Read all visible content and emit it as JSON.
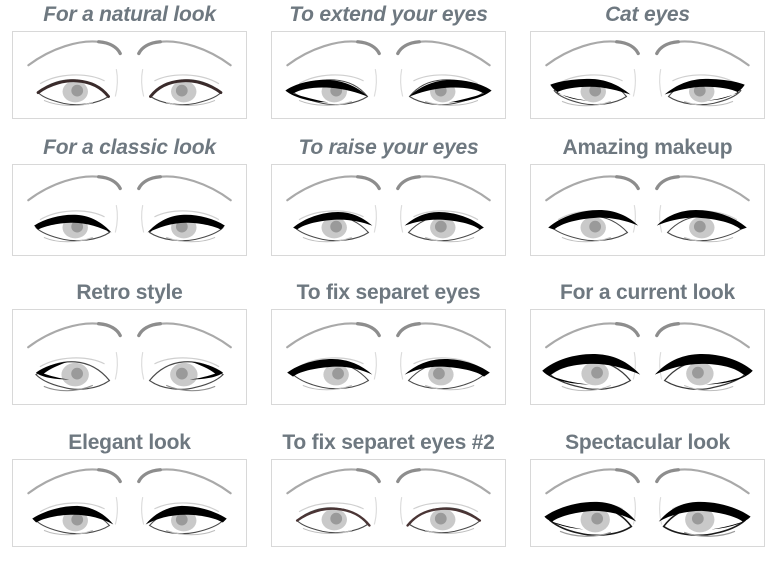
{
  "page": {
    "kind": "eyeliner-styles-chart",
    "columns": 3,
    "rows": 4,
    "title_color": "#6e7880",
    "panel_border_color": "#d8d8d8",
    "background": "#ffffff"
  },
  "styles": [
    {
      "id": "for-a-natural-look",
      "label": "For a natural look",
      "italic": true,
      "liner": "thin-tapered",
      "liner_color": "#3a2b2b",
      "wing": "none"
    },
    {
      "id": "to-extend-your-eyes",
      "label": "To extend your eyes",
      "italic": true,
      "liner": "inner-and-outer-extended",
      "liner_color": "#000000",
      "wing": "outer-point"
    },
    {
      "id": "cat-eyes",
      "label": "Cat eyes",
      "italic": true,
      "liner": "thick-inner-to-outer-wing",
      "liner_color": "#000000",
      "wing": "long-upswept"
    },
    {
      "id": "for-a-classic-look",
      "label": "For a classic look",
      "italic": true,
      "liner": "classic-medium",
      "liner_color": "#000000",
      "wing": "small"
    },
    {
      "id": "to-raise-your-eyes",
      "label": "To raise your eyes",
      "italic": true,
      "liner": "lifted-upward",
      "liner_color": "#000000",
      "wing": "upward"
    },
    {
      "id": "amazing-makeup",
      "label": "Amazing makeup",
      "italic": false,
      "liner": "bold-thick",
      "liner_color": "#000000",
      "wing": "broad"
    },
    {
      "id": "retro-style",
      "label": "Retro style",
      "italic": false,
      "liner": "inner-corner-accent",
      "liner_color": "#000000",
      "wing": "short-downward"
    },
    {
      "id": "to-fix-separet-eyes",
      "label": "To fix separet eyes",
      "italic": false,
      "liner": "inner-heavy",
      "liner_color": "#000000",
      "wing": "outer-triangle"
    },
    {
      "id": "for-a-current-look",
      "label": "For a current look",
      "italic": false,
      "liner": "very-thick-full",
      "liner_color": "#000000",
      "wing": "sharp-long"
    },
    {
      "id": "elegant-look",
      "label": "Elegant look",
      "italic": false,
      "liner": "elegant-tapered",
      "liner_color": "#000000",
      "wing": "fine"
    },
    {
      "id": "to-fix-separet-eyes-2",
      "label": "To fix separet eyes #2",
      "italic": false,
      "liner": "soft-brown-thin",
      "liner_color": "#4a3535",
      "wing": "none"
    },
    {
      "id": "spectacular-look",
      "label": "Spectacular look",
      "italic": false,
      "liner": "dramatic-full-rim",
      "liner_color": "#000000",
      "wing": "dramatic"
    }
  ]
}
